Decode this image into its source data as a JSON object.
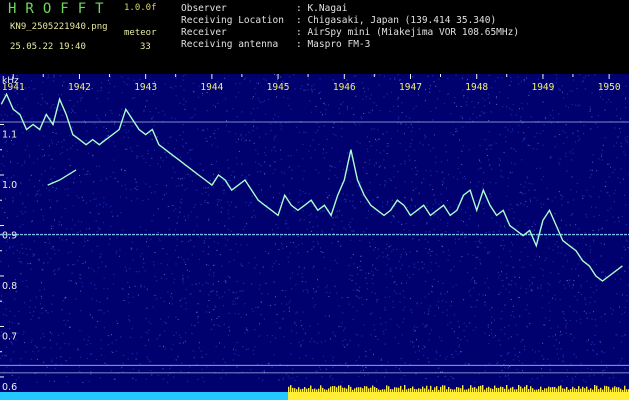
{
  "header": {
    "app_title": "HROFFT",
    "version": "1.0.0f",
    "file_name": "KN9_2505221940.png",
    "meteor_label": "meteor",
    "datetime": "25.05.22 19:40",
    "meteor_count": "33",
    "info": [
      {
        "label": "Observer",
        "value": ": K.Nagai"
      },
      {
        "label": "Receiving Location",
        "value": ": Chigasaki, Japan (139.414 35.340)"
      },
      {
        "label": "Receiver",
        "value": ": AirSpy mini (Miakejima VOR 108.65MHz)"
      },
      {
        "label": "Receiving antenna",
        "value": ": Maspro FM-3"
      }
    ]
  },
  "colors": {
    "background": "#00006e",
    "trace": "#a8ffd0",
    "axis": "#f0f0f0",
    "time_label": "#f0f070",
    "bar_cyan": "#22c8ff",
    "bar_yellow": "#ffee33"
  },
  "chart_data": {
    "type": "heatmap",
    "ylabel": "kHz",
    "ylim": [
      0.59,
      1.2
    ],
    "yticks": [
      "1.1",
      "1.0",
      "0.9",
      "0.8",
      "0.7",
      "0.6"
    ],
    "ytick_values": [
      1.1,
      1.0,
      0.9,
      0.8,
      0.7,
      0.6
    ],
    "xlim": [
      1940.8,
      1950.3
    ],
    "xticks": [
      "1941",
      "1942",
      "1943",
      "1944",
      "1945",
      "1946",
      "1947",
      "1948",
      "1949",
      "1950"
    ],
    "xtick_values": [
      1941,
      1942,
      1943,
      1944,
      1945,
      1946,
      1947,
      1948,
      1949,
      1950
    ],
    "grid": false,
    "carriers": [
      0.882,
      1.105,
      0.623,
      0.608
    ],
    "trace": {
      "name": "",
      "x": [
        1940.82,
        1940.9,
        1941.0,
        1941.1,
        1941.2,
        1941.3,
        1941.4,
        1941.5,
        1941.6,
        1941.7,
        1941.8,
        1941.9,
        1942.0,
        1942.1,
        1942.2,
        1942.3,
        1942.4,
        1942.5,
        1942.6,
        1942.7,
        1942.8,
        1942.9,
        1943.0,
        1943.1,
        1943.2,
        1943.3,
        1943.4,
        1943.5,
        1943.6,
        1943.7,
        1943.8,
        1943.9,
        1944.0,
        1944.1,
        1944.2,
        1944.3,
        1944.4,
        1944.5,
        1944.6,
        1944.7,
        1944.8,
        1944.9,
        1945.0,
        1945.1,
        1945.2,
        1945.3,
        1945.4,
        1945.5,
        1945.6,
        1945.7,
        1945.8,
        1945.9,
        1946.0,
        1946.1,
        1946.2,
        1946.3,
        1946.4,
        1946.5,
        1946.6,
        1946.7,
        1946.8,
        1946.9,
        1947.0,
        1947.1,
        1947.2,
        1947.3,
        1947.4,
        1947.5,
        1947.6,
        1947.7,
        1947.8,
        1947.9,
        1948.0,
        1948.1,
        1948.2,
        1948.3,
        1948.4,
        1948.5,
        1948.6,
        1948.7,
        1948.8,
        1948.9,
        1949.0,
        1949.1,
        1949.2,
        1949.3,
        1949.4,
        1949.5,
        1949.6,
        1949.7,
        1949.8,
        1949.9,
        1950.0,
        1950.1,
        1950.2
      ],
      "y": [
        1.14,
        1.16,
        1.13,
        1.12,
        1.09,
        1.1,
        1.09,
        1.12,
        1.1,
        1.15,
        1.12,
        1.08,
        1.07,
        1.06,
        1.07,
        1.06,
        1.07,
        1.08,
        1.09,
        1.13,
        1.11,
        1.09,
        1.08,
        1.09,
        1.06,
        1.05,
        1.04,
        1.03,
        1.02,
        1.01,
        1.0,
        0.99,
        0.98,
        1.0,
        0.99,
        0.97,
        0.98,
        0.99,
        0.97,
        0.95,
        0.94,
        0.93,
        0.92,
        0.96,
        0.94,
        0.93,
        0.94,
        0.95,
        0.93,
        0.94,
        0.92,
        0.96,
        0.99,
        1.05,
        0.99,
        0.96,
        0.94,
        0.93,
        0.92,
        0.93,
        0.95,
        0.94,
        0.92,
        0.93,
        0.94,
        0.92,
        0.93,
        0.94,
        0.92,
        0.93,
        0.96,
        0.97,
        0.93,
        0.97,
        0.94,
        0.92,
        0.93,
        0.9,
        0.89,
        0.88,
        0.89,
        0.86,
        0.91,
        0.93,
        0.9,
        0.87,
        0.86,
        0.85,
        0.83,
        0.82,
        0.8,
        0.79,
        0.8,
        0.81,
        0.82
      ]
    },
    "fragment": {
      "x": [
        1941.52,
        1941.7,
        1941.95
      ],
      "y": [
        0.98,
        0.99,
        1.01
      ]
    },
    "bottom_bars": [
      {
        "color": "cyan",
        "x": [
          1940.8,
          1945.15
        ]
      },
      {
        "color": "yellow",
        "x": [
          1945.15,
          1950.3
        ]
      }
    ]
  }
}
